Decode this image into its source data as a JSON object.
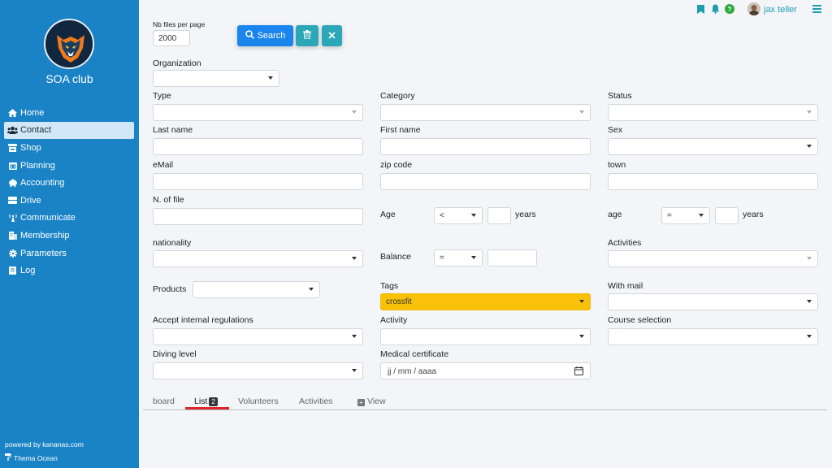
{
  "sidebar": {
    "club_name": "SOA club",
    "items": [
      {
        "label": "Home",
        "icon": "home-icon"
      },
      {
        "label": "Contact",
        "icon": "users-icon"
      },
      {
        "label": "Shop",
        "icon": "shop-icon"
      },
      {
        "label": "Planning",
        "icon": "calendar-icon"
      },
      {
        "label": "Accounting",
        "icon": "piggy-bank-icon"
      },
      {
        "label": "Drive",
        "icon": "drive-icon"
      },
      {
        "label": "Communicate",
        "icon": "broadcast-icon"
      },
      {
        "label": "Membership",
        "icon": "membership-icon"
      },
      {
        "label": "Parameters",
        "icon": "gear-icon"
      },
      {
        "label": "Log",
        "icon": "log-icon"
      }
    ],
    "active_item": "Contact",
    "powered_by": "powered by kananas.com",
    "theme": "Thema Ocean"
  },
  "topbar": {
    "username": "jax teller",
    "help_glyph": "?"
  },
  "toolbar": {
    "nb_files_label": "Nb files per page",
    "nb_files_value": "2000",
    "search_label": "Search"
  },
  "form": {
    "organization": "Organization",
    "type": "Type",
    "category": "Category",
    "status": "Status",
    "last_name": "Last name",
    "first_name": "First name",
    "sex": "Sex",
    "email": "eMail",
    "zip_code": "zip code",
    "town": "town",
    "n_of_file": "N. of file",
    "age_label": "Age",
    "age_op": "<",
    "years_label": "years",
    "age2_label": "age",
    "age2_op": "=",
    "nationality": "nationality",
    "balance_label": "Balance",
    "balance_op": "=",
    "activities": "Activities",
    "products": "Products",
    "tags": "Tags",
    "tags_value": "crossfit",
    "with_mail": "With mail",
    "accept_regulations": "Accept internal regulations",
    "activity": "Activity",
    "course_selection": "Course selection",
    "diving_level": "Diving level",
    "medical_certificate": "Medical certificate",
    "date_placeholder": "jj / mm / aaaa"
  },
  "tabs": [
    {
      "label": "board"
    },
    {
      "label": "List",
      "badge": "2"
    },
    {
      "label": "Volunteers"
    },
    {
      "label": "Activities"
    },
    {
      "label": "View"
    }
  ],
  "colors": {
    "sidebar": "#1a83c6",
    "accent": "#1b85ee",
    "teal": "#2ba7b8",
    "tags": "#f9c108",
    "active_tab": "#e0242e"
  }
}
